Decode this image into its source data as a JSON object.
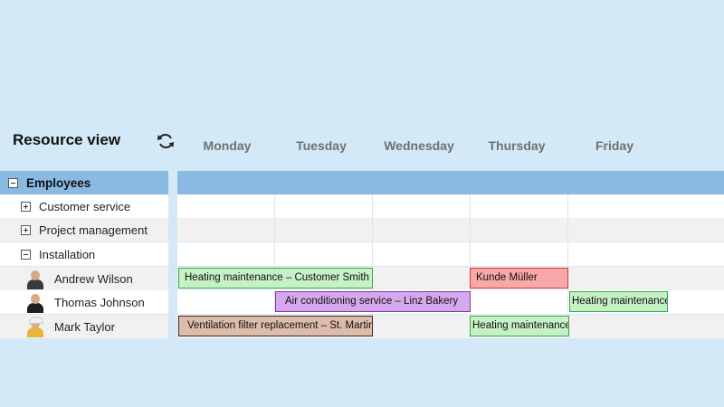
{
  "header": {
    "title": "Resource view",
    "refresh_icon": "refresh-icon"
  },
  "days": [
    "Monday",
    "Tuesday",
    "Wednesday",
    "Thursday",
    "Friday"
  ],
  "tree": {
    "root": "Employees",
    "groups": [
      "Customer service",
      "Project management",
      "Installation"
    ],
    "employees": [
      "Andrew Wilson",
      "Thomas Johnson",
      "Mark Taylor"
    ]
  },
  "events": [
    {
      "employee": "Andrew Wilson",
      "label": "Heating maintenance – Customer Smith",
      "color": "#c6f0c6"
    },
    {
      "employee": "Andrew Wilson",
      "label": "Kunde Müller",
      "color": "#f8a8a8"
    },
    {
      "employee": "Thomas Johnson",
      "label": "Air conditioning service – Linz Bakery",
      "color": "#d8a8ee"
    },
    {
      "employee": "Thomas Johnson",
      "label": "Heating maintenance",
      "color": "#c6f0c6"
    },
    {
      "employee": "Mark Taylor",
      "label": "Ventilation filter replacement – St. Martin",
      "color": "#ddbcaa"
    },
    {
      "employee": "Mark Taylor",
      "label": "Heating maintenance",
      "color": "#c6f0c6"
    }
  ],
  "colors": {
    "background": "#d3e9f7",
    "header_band": "#8ab9e2"
  }
}
